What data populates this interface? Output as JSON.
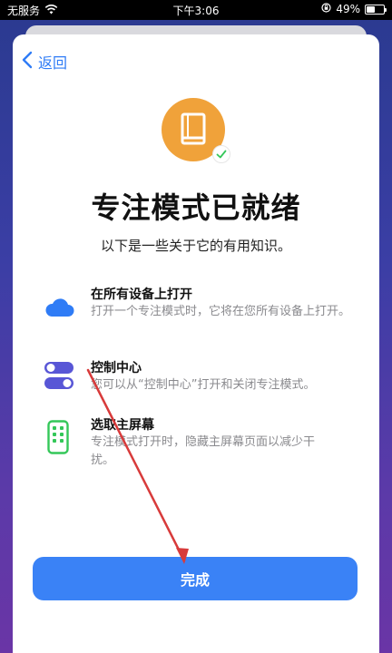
{
  "status_bar": {
    "carrier": "无服务",
    "time": "下午3:06",
    "battery_percent": "49%",
    "battery_level": 0.49
  },
  "nav": {
    "back_label": "返回"
  },
  "header": {
    "icon": "book-icon",
    "badge_icon": "checkmark-icon",
    "title": "专注模式已就绪",
    "subtitle": "以下是一些关于它的有用知识。"
  },
  "features": [
    {
      "icon": "cloud-icon",
      "title": "在所有设备上打开",
      "desc": "打开一个专注模式时，它将在您所有设备上打开。"
    },
    {
      "icon": "toggle-icon",
      "title": "控制中心",
      "desc": "您可以从“控制中心”打开和关闭专注模式。"
    },
    {
      "icon": "phone-home-icon",
      "title": "选取主屏幕",
      "desc": "专注模式打开时，隐藏主屏幕页面以减少干扰。"
    }
  ],
  "footer": {
    "done_label": "完成"
  },
  "colors": {
    "accent": "#3a82f6",
    "link": "#2f7cf6",
    "book_badge": "#f0a23a",
    "cloud": "#2f7cf6",
    "toggle": "#5856d6",
    "phone": "#34c759",
    "annotation_arrow": "#d83b3b"
  }
}
